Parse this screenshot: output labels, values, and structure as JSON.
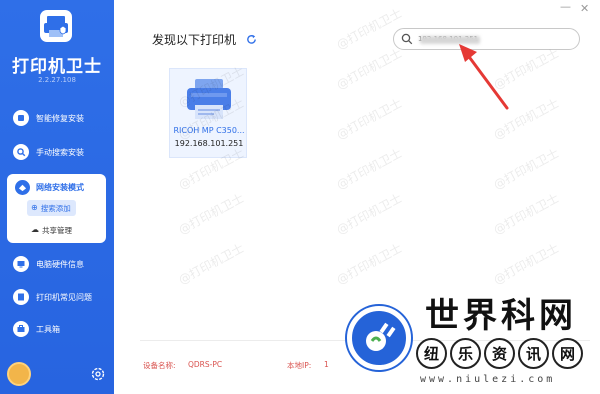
{
  "app": {
    "title": "打印机卫士",
    "version": "2.2.27.108"
  },
  "sidebar": {
    "items": [
      {
        "label": "智能修复安装",
        "icon": "wrench-install-icon"
      },
      {
        "label": "手动搜索安装",
        "icon": "hand-search-icon"
      },
      {
        "label": "网络安装模式",
        "icon": "network-icon"
      },
      {
        "label": "电脑硬件信息",
        "icon": "hardware-info-icon"
      },
      {
        "label": "打印机常见问题",
        "icon": "faq-icon"
      },
      {
        "label": "工具箱",
        "icon": "toolbox-icon"
      }
    ],
    "sub_items": [
      {
        "label": "搜索添加",
        "icon": "search-add-icon"
      },
      {
        "label": "共享管理",
        "icon": "cloud-share-icon"
      }
    ]
  },
  "main": {
    "title": "发现以下打印机",
    "search": {
      "value": "192.168.101.251",
      "placeholder": ""
    },
    "printers": [
      {
        "name": "RICOH MP C350...",
        "ip": "192.168.101.251"
      }
    ],
    "footer": {
      "device_label": "设备名称:",
      "device_value": "QDRS-PC",
      "ip_label": "本地IP:",
      "ip_value": "1"
    }
  },
  "watermark": "@打印机卫士",
  "overlay": {
    "brand_big": "世界科网",
    "brand_chars": [
      "纽",
      "乐",
      "资",
      "讯",
      "网"
    ],
    "brand_url": "www.niulezi.com"
  },
  "colors": {
    "sidebar_bg": "#2f6fe8",
    "accent": "#2f6fe8",
    "card_bg": "#eef4ff",
    "footer_text": "#d9534f",
    "arrow": "#e53935"
  }
}
